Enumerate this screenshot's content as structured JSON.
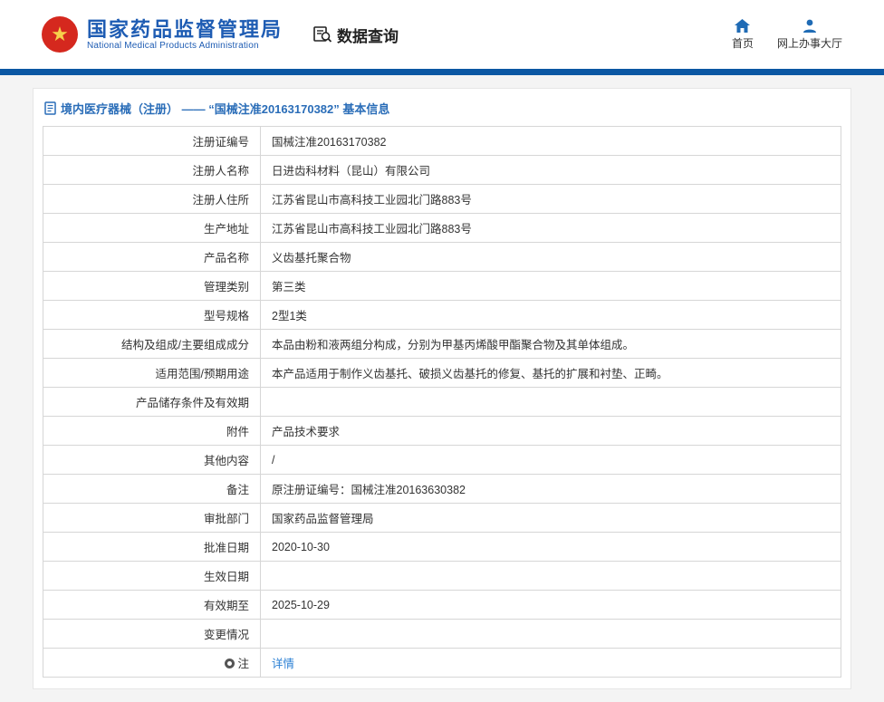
{
  "header": {
    "org_name_cn": "国家药品监督管理局",
    "org_name_en": "National Medical Products Administration",
    "nav_query": "数据查询",
    "nav_home": "首页",
    "nav_hall": "网上办事大厅"
  },
  "page_title": "境内医疗器械（注册） —— “国械注准20163170382” 基本信息",
  "table": {
    "rows": [
      {
        "label": "注册证编号",
        "value": "国械注准20163170382"
      },
      {
        "label": "注册人名称",
        "value": "日进齿科材料（昆山）有限公司"
      },
      {
        "label": "注册人住所",
        "value": "江苏省昆山市高科技工业园北门路883号"
      },
      {
        "label": "生产地址",
        "value": "江苏省昆山市高科技工业园北门路883号"
      },
      {
        "label": "产品名称",
        "value": "义齿基托聚合物"
      },
      {
        "label": "管理类别",
        "value": "第三类"
      },
      {
        "label": "型号规格",
        "value": "2型1类"
      },
      {
        "label": "结构及组成/主要组成成分",
        "value": "本品由粉和液两组分构成，分别为甲基丙烯酸甲酯聚合物及其单体组成。"
      },
      {
        "label": "适用范围/预期用途",
        "value": "本产品适用于制作义齿基托、破损义齿基托的修复、基托的扩展和衬垫、正畸。"
      },
      {
        "label": "产品储存条件及有效期",
        "value": ""
      },
      {
        "label": "附件",
        "value": "产品技术要求"
      },
      {
        "label": "其他内容",
        "value": "/"
      },
      {
        "label": "备注",
        "value": "原注册证编号：国械注准20163630382"
      },
      {
        "label": "审批部门",
        "value": "国家药品监督管理局"
      },
      {
        "label": "批准日期",
        "value": "2020-10-30"
      },
      {
        "label": "生效日期",
        "value": ""
      },
      {
        "label": "有效期至",
        "value": "2025-10-29"
      },
      {
        "label": "变更情况",
        "value": ""
      },
      {
        "label": "注",
        "value": "详情",
        "link": true,
        "icon": true
      }
    ]
  },
  "icons": {
    "logo": "national-emblem",
    "query": "document-search-icon",
    "home": "home-icon",
    "hall": "person-icon",
    "title": "document-icon",
    "note": "note-icon"
  },
  "colors": {
    "brand_blue": "#1e5cb3",
    "bar_blue": "#0b57a3",
    "title_blue": "#2a6db8",
    "link_blue": "#2a7fd4",
    "logo_red": "#d5281e",
    "logo_gold": "#f7d04b",
    "page_bg": "#f4f4f4",
    "table_border": "#d6d6d6"
  }
}
